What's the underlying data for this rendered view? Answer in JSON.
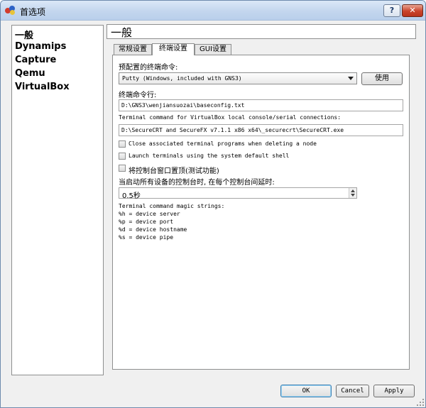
{
  "window": {
    "title": "首选项",
    "help_label": "?",
    "close_label": "✕"
  },
  "sidebar": {
    "items": [
      {
        "label": "一般"
      },
      {
        "label": "Dynamips"
      },
      {
        "label": "Capture"
      },
      {
        "label": "Qemu"
      },
      {
        "label": "VirtualBox"
      }
    ]
  },
  "header": {
    "title": "一般"
  },
  "tabs": [
    {
      "label": "常规设置"
    },
    {
      "label": "终端设置"
    },
    {
      "label": "GUI设置"
    }
  ],
  "terminal": {
    "preset_label": "预配置的终端命令:",
    "preset_value": "Putty (Windows, included with GNS3)",
    "use_button": "使用",
    "command_label": "终端命令行:",
    "command_value": "D:\\GNS3\\wenjiansuozai\\baseconfig.txt",
    "vbox_label": "Terminal command for VirtualBox local console/serial connections:",
    "vbox_value": "D:\\SecureCRT and SecureFX v7.1.1 x86 x64\\_securecrt\\SecureCRT.exe",
    "checkbox_close": "Close associated terminal programs when deleting a node",
    "checkbox_launch": "Launch terminals using the system default shell",
    "checkbox_ontop": "将控制台窗口置顶(测试功能)",
    "delay_label": "当启动所有设备的控制台时, 在每个控制台间延时:",
    "delay_value": "0.5秒",
    "magic_title": "Terminal command magic strings:",
    "magic_lines": [
      "%h = device server",
      "%p = device port",
      "%d = device hostname",
      "%s = device pipe"
    ]
  },
  "footer": {
    "ok": "OK",
    "cancel": "Cancel",
    "apply": "Apply"
  }
}
